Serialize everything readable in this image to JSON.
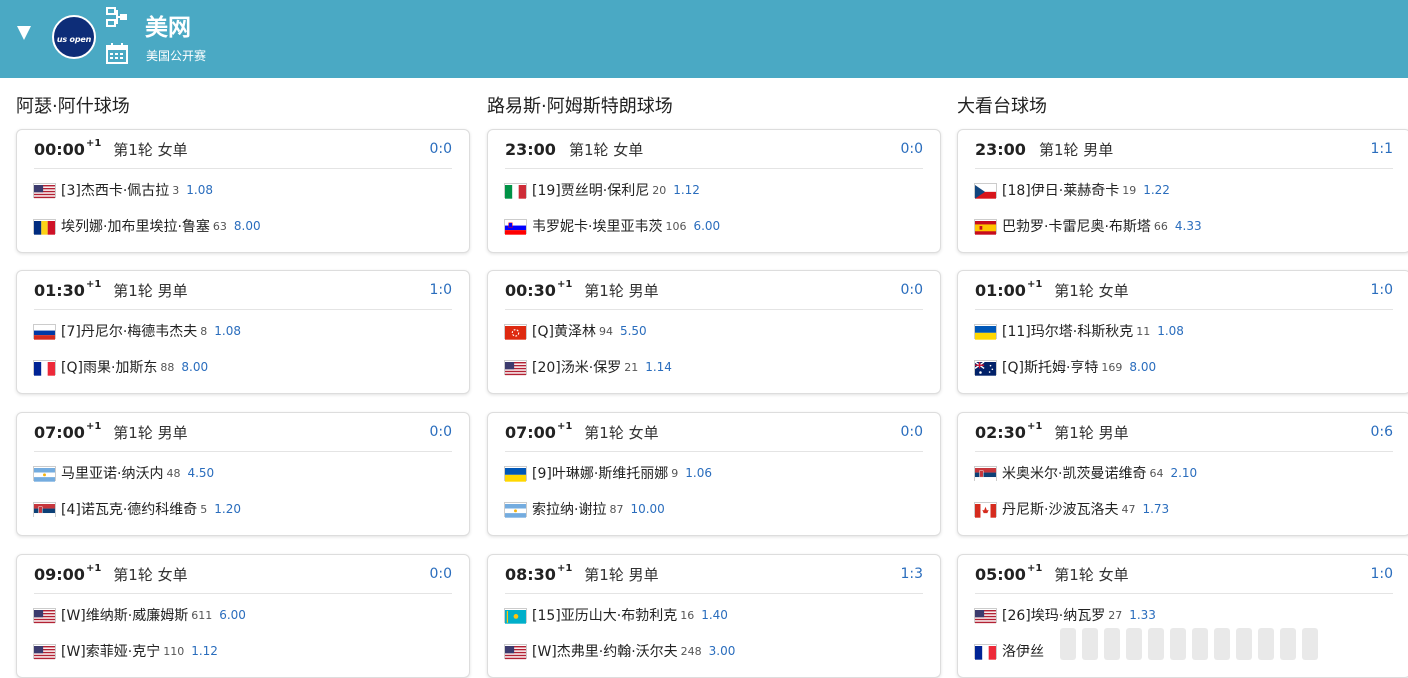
{
  "header": {
    "title": "美网",
    "subtitle": "美国公开赛",
    "logo_text": "us open"
  },
  "courts": [
    {
      "title": "阿瑟·阿什球场"
    },
    {
      "title": "路易斯·阿姆斯特朗球场"
    },
    {
      "title": "大看台球场"
    }
  ],
  "matches": [
    [
      {
        "time": "00:00",
        "plus": "+1",
        "round": "第1轮 女单",
        "score": "0:0",
        "p1": {
          "flag": "us",
          "name": "[3]杰西卡·佩古拉",
          "rank": "3",
          "odds": "1.08"
        },
        "p2": {
          "flag": "ro",
          "name": "埃列娜·加布里埃拉·鲁塞",
          "rank": "63",
          "odds": "8.00"
        }
      },
      {
        "time": "01:30",
        "plus": "+1",
        "round": "第1轮 男单",
        "score": "1:0",
        "p1": {
          "flag": "ru",
          "name": "[7]丹尼尔·梅德韦杰夫",
          "rank": "8",
          "odds": "1.08"
        },
        "p2": {
          "flag": "fr",
          "name": "[Q]雨果·加斯东",
          "rank": "88",
          "odds": "8.00"
        }
      },
      {
        "time": "07:00",
        "plus": "+1",
        "round": "第1轮 男单",
        "score": "0:0",
        "p1": {
          "flag": "ar",
          "name": "马里亚诺·纳沃内",
          "rank": "48",
          "odds": "4.50"
        },
        "p2": {
          "flag": "rs",
          "name": "[4]诺瓦克·德约科维奇",
          "rank": "5",
          "odds": "1.20"
        }
      },
      {
        "time": "09:00",
        "plus": "+1",
        "round": "第1轮 女单",
        "score": "0:0",
        "p1": {
          "flag": "us",
          "name": "[W]维纳斯·威廉姆斯",
          "rank": "611",
          "odds": "6.00"
        },
        "p2": {
          "flag": "us",
          "name": "[W]索菲娅·克宁",
          "rank": "110",
          "odds": "1.12"
        }
      }
    ],
    [
      {
        "time": "23:00",
        "plus": "",
        "round": "第1轮 女单",
        "score": "0:0",
        "p1": {
          "flag": "it",
          "name": "[19]贾丝明·保利尼",
          "rank": "20",
          "odds": "1.12"
        },
        "p2": {
          "flag": "si",
          "name": "韦罗妮卡·埃里亚韦茨",
          "rank": "106",
          "odds": "6.00"
        }
      },
      {
        "time": "00:30",
        "plus": "+1",
        "round": "第1轮 男单",
        "score": "0:0",
        "p1": {
          "flag": "hk",
          "name": "[Q]黄泽林",
          "rank": "94",
          "odds": "5.50"
        },
        "p2": {
          "flag": "us",
          "name": "[20]汤米·保罗",
          "rank": "21",
          "odds": "1.14"
        }
      },
      {
        "time": "07:00",
        "plus": "+1",
        "round": "第1轮 女单",
        "score": "0:0",
        "p1": {
          "flag": "ua",
          "name": "[9]叶琳娜·斯维托丽娜",
          "rank": "9",
          "odds": "1.06"
        },
        "p2": {
          "flag": "ar",
          "name": "索拉纳·谢拉",
          "rank": "87",
          "odds": "10.00"
        }
      },
      {
        "time": "08:30",
        "plus": "+1",
        "round": "第1轮 男单",
        "score": "1:3",
        "p1": {
          "flag": "kz",
          "name": "[15]亚历山大·布勃利克",
          "rank": "16",
          "odds": "1.40"
        },
        "p2": {
          "flag": "us",
          "name": "[W]杰弗里·约翰·沃尔夫",
          "rank": "248",
          "odds": "3.00"
        }
      }
    ],
    [
      {
        "time": "23:00",
        "plus": "",
        "round": "第1轮 男单",
        "score": "1:1",
        "p1": {
          "flag": "cz",
          "name": "[18]伊日·莱赫奇卡",
          "rank": "19",
          "odds": "1.22"
        },
        "p2": {
          "flag": "es",
          "name": "巴勃罗·卡雷尼奥·布斯塔",
          "rank": "66",
          "odds": "4.33"
        }
      },
      {
        "time": "01:00",
        "plus": "+1",
        "round": "第1轮 女单",
        "score": "1:0",
        "p1": {
          "flag": "ua",
          "name": "[11]玛尔塔·科斯秋克",
          "rank": "11",
          "odds": "1.08"
        },
        "p2": {
          "flag": "au",
          "name": "[Q]斯托姆·亨特",
          "rank": "169",
          "odds": "8.00"
        }
      },
      {
        "time": "02:30",
        "plus": "+1",
        "round": "第1轮 男单",
        "score": "0:6",
        "p1": {
          "flag": "rs",
          "name": "米奥米尔·凯茨曼诺维奇",
          "rank": "64",
          "odds": "2.10"
        },
        "p2": {
          "flag": "ca",
          "name": "丹尼斯·沙波瓦洛夫",
          "rank": "47",
          "odds": "1.73"
        }
      },
      {
        "time": "05:00",
        "plus": "+1",
        "round": "第1轮 女单",
        "score": "1:0",
        "p1": {
          "flag": "us",
          "name": "[26]埃玛·纳瓦罗",
          "rank": "27",
          "odds": "1.33"
        },
        "p2": {
          "flag": "fr",
          "name": "洛伊丝",
          "rank": "",
          "odds": ""
        }
      }
    ]
  ],
  "colors": {
    "header_bg": "#4aa9c4",
    "score": "#2a6dbd",
    "odds": "#2a6dbd"
  }
}
